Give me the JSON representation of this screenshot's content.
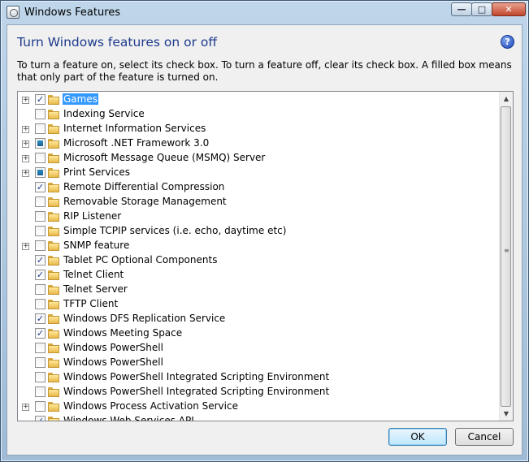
{
  "window": {
    "title": "Windows Features",
    "minimize_label": "—",
    "maximize_label": "□",
    "close_label": "✕"
  },
  "heading": "Turn Windows features on or off",
  "help_label": "?",
  "description": "To turn a feature on, select its check box. To turn a feature off, clear its check box. A filled box means that only part of the feature is turned on.",
  "features": [
    {
      "label": "Games",
      "state": "checked",
      "expandable": true,
      "selected": true
    },
    {
      "label": "Indexing Service",
      "state": "unchecked",
      "expandable": false
    },
    {
      "label": "Internet Information Services",
      "state": "unchecked",
      "expandable": true
    },
    {
      "label": "Microsoft .NET Framework 3.0",
      "state": "partial",
      "expandable": true
    },
    {
      "label": "Microsoft Message Queue (MSMQ) Server",
      "state": "unchecked",
      "expandable": true
    },
    {
      "label": "Print Services",
      "state": "partial",
      "expandable": true
    },
    {
      "label": "Remote Differential Compression",
      "state": "checked",
      "expandable": false
    },
    {
      "label": "Removable Storage Management",
      "state": "unchecked",
      "expandable": false
    },
    {
      "label": "RIP Listener",
      "state": "unchecked",
      "expandable": false
    },
    {
      "label": "Simple TCPIP services (i.e. echo, daytime etc)",
      "state": "unchecked",
      "expandable": false
    },
    {
      "label": "SNMP feature",
      "state": "unchecked",
      "expandable": true
    },
    {
      "label": "Tablet PC Optional Components",
      "state": "checked",
      "expandable": false
    },
    {
      "label": "Telnet Client",
      "state": "checked",
      "expandable": false
    },
    {
      "label": "Telnet Server",
      "state": "unchecked",
      "expandable": false
    },
    {
      "label": "TFTP Client",
      "state": "unchecked",
      "expandable": false
    },
    {
      "label": "Windows DFS Replication Service",
      "state": "checked",
      "expandable": false
    },
    {
      "label": "Windows Meeting Space",
      "state": "checked",
      "expandable": false
    },
    {
      "label": "Windows PowerShell",
      "state": "unchecked",
      "expandable": false
    },
    {
      "label": "Windows PowerShell",
      "state": "unchecked",
      "expandable": false
    },
    {
      "label": "Windows PowerShell Integrated Scripting Environment",
      "state": "unchecked",
      "expandable": false
    },
    {
      "label": "Windows PowerShell Integrated Scripting Environment",
      "state": "unchecked",
      "expandable": false
    },
    {
      "label": "Windows Process Activation Service",
      "state": "unchecked",
      "expandable": true
    },
    {
      "label": "Windows Web Services API",
      "state": "checked",
      "expandable": false
    }
  ],
  "scrollbar": {
    "up": "▲",
    "down": "▼",
    "grip": "≡"
  },
  "buttons": {
    "ok": "OK",
    "cancel": "Cancel"
  },
  "colors": {
    "heading": "#1e3a8c",
    "selection": "#3399ff"
  }
}
